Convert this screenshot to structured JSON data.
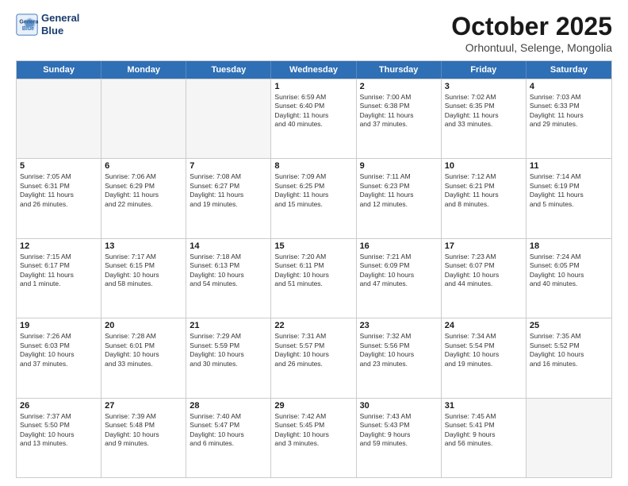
{
  "header": {
    "logo_line1": "General",
    "logo_line2": "Blue",
    "month_title": "October 2025",
    "subtitle": "Orhontuul, Selenge, Mongolia"
  },
  "days_of_week": [
    "Sunday",
    "Monday",
    "Tuesday",
    "Wednesday",
    "Thursday",
    "Friday",
    "Saturday"
  ],
  "rows": [
    [
      {
        "day": "",
        "lines": [],
        "empty": true
      },
      {
        "day": "",
        "lines": [],
        "empty": true
      },
      {
        "day": "",
        "lines": [],
        "empty": true
      },
      {
        "day": "1",
        "lines": [
          "Sunrise: 6:59 AM",
          "Sunset: 6:40 PM",
          "Daylight: 11 hours",
          "and 40 minutes."
        ]
      },
      {
        "day": "2",
        "lines": [
          "Sunrise: 7:00 AM",
          "Sunset: 6:38 PM",
          "Daylight: 11 hours",
          "and 37 minutes."
        ]
      },
      {
        "day": "3",
        "lines": [
          "Sunrise: 7:02 AM",
          "Sunset: 6:35 PM",
          "Daylight: 11 hours",
          "and 33 minutes."
        ]
      },
      {
        "day": "4",
        "lines": [
          "Sunrise: 7:03 AM",
          "Sunset: 6:33 PM",
          "Daylight: 11 hours",
          "and 29 minutes."
        ]
      }
    ],
    [
      {
        "day": "5",
        "lines": [
          "Sunrise: 7:05 AM",
          "Sunset: 6:31 PM",
          "Daylight: 11 hours",
          "and 26 minutes."
        ]
      },
      {
        "day": "6",
        "lines": [
          "Sunrise: 7:06 AM",
          "Sunset: 6:29 PM",
          "Daylight: 11 hours",
          "and 22 minutes."
        ]
      },
      {
        "day": "7",
        "lines": [
          "Sunrise: 7:08 AM",
          "Sunset: 6:27 PM",
          "Daylight: 11 hours",
          "and 19 minutes."
        ]
      },
      {
        "day": "8",
        "lines": [
          "Sunrise: 7:09 AM",
          "Sunset: 6:25 PM",
          "Daylight: 11 hours",
          "and 15 minutes."
        ]
      },
      {
        "day": "9",
        "lines": [
          "Sunrise: 7:11 AM",
          "Sunset: 6:23 PM",
          "Daylight: 11 hours",
          "and 12 minutes."
        ]
      },
      {
        "day": "10",
        "lines": [
          "Sunrise: 7:12 AM",
          "Sunset: 6:21 PM",
          "Daylight: 11 hours",
          "and 8 minutes."
        ]
      },
      {
        "day": "11",
        "lines": [
          "Sunrise: 7:14 AM",
          "Sunset: 6:19 PM",
          "Daylight: 11 hours",
          "and 5 minutes."
        ]
      }
    ],
    [
      {
        "day": "12",
        "lines": [
          "Sunrise: 7:15 AM",
          "Sunset: 6:17 PM",
          "Daylight: 11 hours",
          "and 1 minute."
        ]
      },
      {
        "day": "13",
        "lines": [
          "Sunrise: 7:17 AM",
          "Sunset: 6:15 PM",
          "Daylight: 10 hours",
          "and 58 minutes."
        ]
      },
      {
        "day": "14",
        "lines": [
          "Sunrise: 7:18 AM",
          "Sunset: 6:13 PM",
          "Daylight: 10 hours",
          "and 54 minutes."
        ]
      },
      {
        "day": "15",
        "lines": [
          "Sunrise: 7:20 AM",
          "Sunset: 6:11 PM",
          "Daylight: 10 hours",
          "and 51 minutes."
        ]
      },
      {
        "day": "16",
        "lines": [
          "Sunrise: 7:21 AM",
          "Sunset: 6:09 PM",
          "Daylight: 10 hours",
          "and 47 minutes."
        ]
      },
      {
        "day": "17",
        "lines": [
          "Sunrise: 7:23 AM",
          "Sunset: 6:07 PM",
          "Daylight: 10 hours",
          "and 44 minutes."
        ]
      },
      {
        "day": "18",
        "lines": [
          "Sunrise: 7:24 AM",
          "Sunset: 6:05 PM",
          "Daylight: 10 hours",
          "and 40 minutes."
        ]
      }
    ],
    [
      {
        "day": "19",
        "lines": [
          "Sunrise: 7:26 AM",
          "Sunset: 6:03 PM",
          "Daylight: 10 hours",
          "and 37 minutes."
        ]
      },
      {
        "day": "20",
        "lines": [
          "Sunrise: 7:28 AM",
          "Sunset: 6:01 PM",
          "Daylight: 10 hours",
          "and 33 minutes."
        ]
      },
      {
        "day": "21",
        "lines": [
          "Sunrise: 7:29 AM",
          "Sunset: 5:59 PM",
          "Daylight: 10 hours",
          "and 30 minutes."
        ]
      },
      {
        "day": "22",
        "lines": [
          "Sunrise: 7:31 AM",
          "Sunset: 5:57 PM",
          "Daylight: 10 hours",
          "and 26 minutes."
        ]
      },
      {
        "day": "23",
        "lines": [
          "Sunrise: 7:32 AM",
          "Sunset: 5:56 PM",
          "Daylight: 10 hours",
          "and 23 minutes."
        ]
      },
      {
        "day": "24",
        "lines": [
          "Sunrise: 7:34 AM",
          "Sunset: 5:54 PM",
          "Daylight: 10 hours",
          "and 19 minutes."
        ]
      },
      {
        "day": "25",
        "lines": [
          "Sunrise: 7:35 AM",
          "Sunset: 5:52 PM",
          "Daylight: 10 hours",
          "and 16 minutes."
        ]
      }
    ],
    [
      {
        "day": "26",
        "lines": [
          "Sunrise: 7:37 AM",
          "Sunset: 5:50 PM",
          "Daylight: 10 hours",
          "and 13 minutes."
        ]
      },
      {
        "day": "27",
        "lines": [
          "Sunrise: 7:39 AM",
          "Sunset: 5:48 PM",
          "Daylight: 10 hours",
          "and 9 minutes."
        ]
      },
      {
        "day": "28",
        "lines": [
          "Sunrise: 7:40 AM",
          "Sunset: 5:47 PM",
          "Daylight: 10 hours",
          "and 6 minutes."
        ]
      },
      {
        "day": "29",
        "lines": [
          "Sunrise: 7:42 AM",
          "Sunset: 5:45 PM",
          "Daylight: 10 hours",
          "and 3 minutes."
        ]
      },
      {
        "day": "30",
        "lines": [
          "Sunrise: 7:43 AM",
          "Sunset: 5:43 PM",
          "Daylight: 9 hours",
          "and 59 minutes."
        ]
      },
      {
        "day": "31",
        "lines": [
          "Sunrise: 7:45 AM",
          "Sunset: 5:41 PM",
          "Daylight: 9 hours",
          "and 56 minutes."
        ]
      },
      {
        "day": "",
        "lines": [],
        "empty": true
      }
    ]
  ]
}
